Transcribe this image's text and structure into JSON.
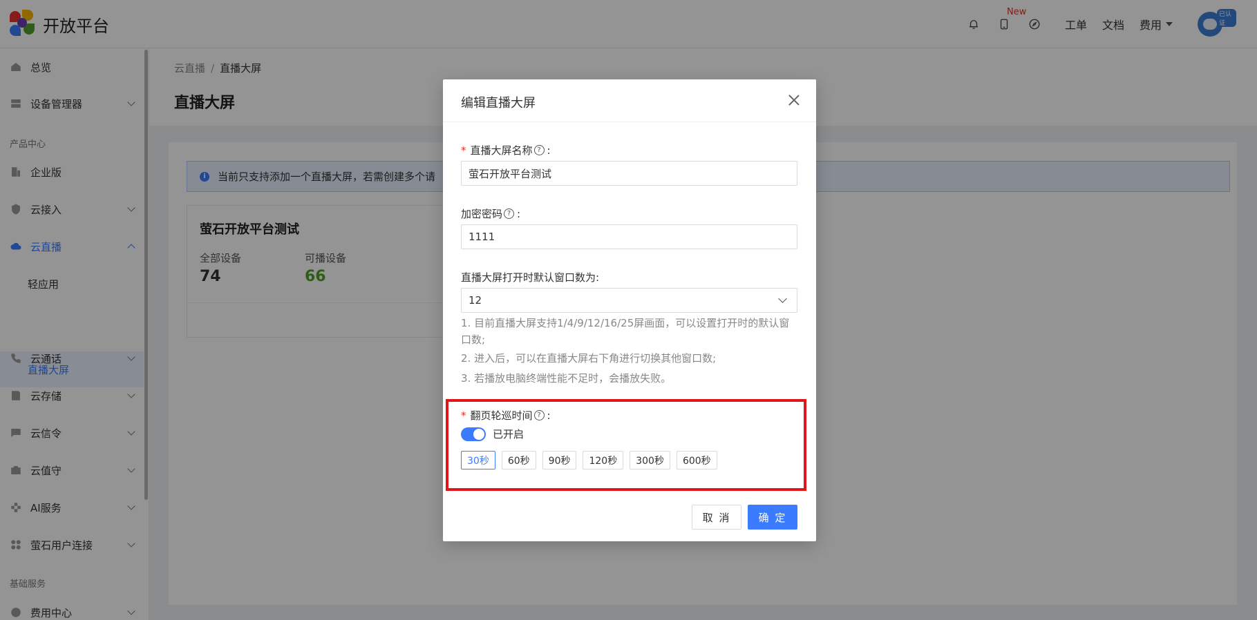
{
  "header": {
    "logo_text": "开放平台",
    "new_badge": "New",
    "links": [
      "工单",
      "文档",
      "费用"
    ],
    "avatar_badge": "已认证"
  },
  "sidebar": {
    "overview": "总览",
    "device_mgmt": "设备管理器",
    "section_product": "产品中心",
    "enterprise": "企业版",
    "cloud_access": "云接入",
    "cloud_live": "云直播",
    "sub_light_app": "轻应用",
    "sub_live_screen": "直播大屏",
    "cloud_call": "云通话",
    "cloud_storage": "云存储",
    "cloud_signal": "云信令",
    "cloud_guard": "云值守",
    "ai_service": "AI服务",
    "user_connect": "萤石用户连接",
    "section_base": "基础服务",
    "fee_center": "费用中心"
  },
  "main": {
    "breadcrumb_parent": "云直播",
    "breadcrumb_sep": "/",
    "breadcrumb_current": "直播大屏",
    "page_title": "直播大屏",
    "notice": "当前只支持添加一个直播大屏，若需创建多个请",
    "card": {
      "title": "萤石开放平台测试",
      "all_devices_label": "全部设备",
      "all_devices_value": "74",
      "playable_label": "可播设备",
      "playable_value": "66"
    }
  },
  "modal": {
    "title": "编辑直播大屏",
    "name_label": "直播大屏名称",
    "name_value": "萤石开放平台测试",
    "pwd_label": "加密密码",
    "pwd_value": "1111",
    "window_label": "直播大屏打开时默认窗口数为:",
    "window_value": "12",
    "tip1": "1. 目前直播大屏支持1/4/9/12/16/25屏画面，可以设置打开时的默认窗口数;",
    "tip2": "2. 进入后，可以在直播大屏右下角进行切换其他窗口数;",
    "tip3": "3. 若播放电脑终端性能不足时，会播放失败。",
    "rotate_label": "翻页轮巡时间",
    "toggle_label": "已开启",
    "options": [
      "30秒",
      "60秒",
      "90秒",
      "120秒",
      "300秒",
      "600秒"
    ],
    "selected_option": "30秒",
    "cancel": "取 消",
    "ok": "确 定",
    "colon": ":"
  },
  "colors": {
    "primary": "#3b7cff",
    "danger": "#e0161b",
    "success": "#52a12a"
  }
}
